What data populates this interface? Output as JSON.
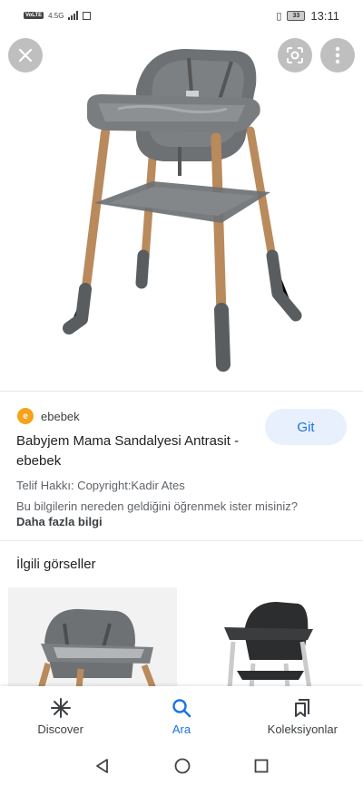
{
  "status_bar": {
    "network": "VoLTE",
    "data_speed": "4.5G",
    "battery": "33",
    "time": "13:11"
  },
  "hero": {
    "close_icon": "close-icon",
    "lens_icon": "google-lens-icon",
    "more_icon": "more-vert-icon"
  },
  "result": {
    "source": "ebebek",
    "title": "Babyjem Mama Sandalyesi Antrasit - ebebek",
    "visit_label": "Git",
    "copyright": "Telif Hakkı: Copyright:Kadir Ates",
    "question": "Bu bilgilerin nereden geldiğini öğrenmek ister misiniz?",
    "more_info": "Daha fazla bilgi"
  },
  "related": {
    "heading": "İlgili görseller"
  },
  "bottom_nav": {
    "items": [
      {
        "label": "Discover",
        "icon": "discover-icon"
      },
      {
        "label": "Ara",
        "icon": "search-icon"
      },
      {
        "label": "Koleksiyonlar",
        "icon": "collections-icon"
      }
    ],
    "active_color": "#1a73e8"
  },
  "colors": {
    "chair_gray": "#6e7174",
    "chair_dark": "#4b4e51",
    "wood": "#b98a5c",
    "visit_bg": "#e8f0fe"
  }
}
